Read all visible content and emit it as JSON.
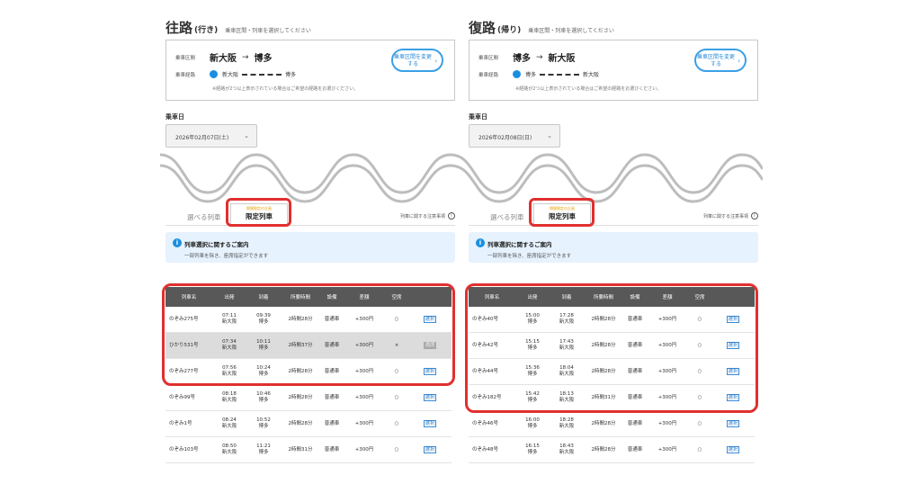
{
  "outbound": {
    "title_main": "往路",
    "title_sub": "(行き)",
    "title_note": "乗車区間・列車を選択してください",
    "route": {
      "section_label": "乗車区間",
      "from": "新大阪",
      "arrow": "→",
      "to": "博多",
      "line_label": "乗車経路",
      "line_from": "新大阪",
      "line_to": "博多",
      "note": "※経路が2つ以上表示されている場合はご希望の経路をお選びください。",
      "change_label": "乗車区間を変更する",
      "chevron": "›"
    },
    "date_label": "乗車日",
    "date_value": "2026年02月07日(土)",
    "date_chevron": "⌄",
    "tabs": {
      "tab1": "選べる列車",
      "tab2_tag": "期間限定の企画",
      "tab2": "限定列車",
      "note": "列車に関する注意事項",
      "info_icon": "i"
    },
    "info": {
      "icon": "i",
      "title": "列車選択に関するご案内",
      "text": "一部列車を除き、座席指定ができます"
    },
    "headers": [
      "列車名",
      "出発",
      "到着",
      "所要時間",
      "設備",
      "差額",
      "空席",
      ""
    ],
    "rows": [
      {
        "name": "のぞみ275号",
        "dep_time": "07:11",
        "dep_st": "新大阪",
        "arr_time": "09:39",
        "arr_st": "博多",
        "dur": "2時間28分",
        "car": "普通車",
        "diff": "+300円",
        "seat": "○",
        "btn": "選択",
        "disabled": false
      },
      {
        "name": "ひかり531号",
        "dep_time": "07:34",
        "dep_st": "新大阪",
        "arr_time": "10:11",
        "arr_st": "博多",
        "dur": "2時間37分",
        "car": "普通車",
        "diff": "+300円",
        "seat": "×",
        "btn": "満席",
        "disabled": true
      },
      {
        "name": "のぞみ277号",
        "dep_time": "07:56",
        "dep_st": "新大阪",
        "arr_time": "10:24",
        "arr_st": "博多",
        "dur": "2時間28分",
        "car": "普通車",
        "diff": "+300円",
        "seat": "○",
        "btn": "選択",
        "disabled": false
      },
      {
        "name": "のぞみ99号",
        "dep_time": "08:18",
        "dep_st": "新大阪",
        "arr_time": "10:46",
        "arr_st": "博多",
        "dur": "2時間28分",
        "car": "普通車",
        "diff": "+300円",
        "seat": "○",
        "btn": "選択",
        "disabled": false
      },
      {
        "name": "のぞみ1号",
        "dep_time": "08:24",
        "dep_st": "新大阪",
        "arr_time": "10:52",
        "arr_st": "博多",
        "dur": "2時間28分",
        "car": "普通車",
        "diff": "+300円",
        "seat": "○",
        "btn": "選択",
        "disabled": false
      },
      {
        "name": "のぞみ103号",
        "dep_time": "08:50",
        "dep_st": "新大阪",
        "arr_time": "11:21",
        "arr_st": "博多",
        "dur": "2時間31分",
        "car": "普通車",
        "diff": "+300円",
        "seat": "○",
        "btn": "選択",
        "disabled": false
      }
    ]
  },
  "return": {
    "title_main": "復路",
    "title_sub": "(帰り)",
    "title_note": "乗車区間・列車を選択してください",
    "route": {
      "section_label": "乗車区間",
      "from": "博多",
      "arrow": "→",
      "to": "新大阪",
      "line_label": "乗車経路",
      "line_from": "博多",
      "line_to": "新大阪",
      "note": "※経路が2つ以上表示されている場合はご希望の経路をお選びください。",
      "change_label": "乗車区間を変更する",
      "chevron": "›"
    },
    "date_label": "乗車日",
    "date_value": "2026年02月08日(日)",
    "date_chevron": "⌄",
    "tabs": {
      "tab1": "選べる列車",
      "tab2_tag": "期間限定の企画",
      "tab2": "限定列車",
      "note": "列車に関する注意事項",
      "info_icon": "i"
    },
    "info": {
      "icon": "i",
      "title": "列車選択に関するご案内",
      "text": "一部列車を除き、座席指定ができます"
    },
    "headers": [
      "列車名",
      "出発",
      "到着",
      "所要時間",
      "設備",
      "差額",
      "空席",
      ""
    ],
    "rows": [
      {
        "name": "のぞみ40号",
        "dep_time": "15:00",
        "dep_st": "博多",
        "arr_time": "17:28",
        "arr_st": "新大阪",
        "dur": "2時間28分",
        "car": "普通車",
        "diff": "+300円",
        "seat": "○",
        "btn": "選択",
        "disabled": false
      },
      {
        "name": "のぞみ42号",
        "dep_time": "15:15",
        "dep_st": "博多",
        "arr_time": "17:43",
        "arr_st": "新大阪",
        "dur": "2時間28分",
        "car": "普通車",
        "diff": "+300円",
        "seat": "○",
        "btn": "選択",
        "disabled": false
      },
      {
        "name": "のぞみ44号",
        "dep_time": "15:36",
        "dep_st": "博多",
        "arr_time": "18:04",
        "arr_st": "新大阪",
        "dur": "2時間28分",
        "car": "普通車",
        "diff": "+300円",
        "seat": "○",
        "btn": "選択",
        "disabled": false
      },
      {
        "name": "のぞみ182号",
        "dep_time": "15:42",
        "dep_st": "博多",
        "arr_time": "18:13",
        "arr_st": "新大阪",
        "dur": "2時間31分",
        "car": "普通車",
        "diff": "+300円",
        "seat": "○",
        "btn": "選択",
        "disabled": false
      },
      {
        "name": "のぞみ46号",
        "dep_time": "16:00",
        "dep_st": "博多",
        "arr_time": "18:28",
        "arr_st": "新大阪",
        "dur": "2時間28分",
        "car": "普通車",
        "diff": "+300円",
        "seat": "○",
        "btn": "選択",
        "disabled": false
      },
      {
        "name": "のぞみ48号",
        "dep_time": "16:15",
        "dep_st": "博多",
        "arr_time": "18:43",
        "arr_st": "新大阪",
        "dur": "2時間28分",
        "car": "普通車",
        "diff": "+300円",
        "seat": "○",
        "btn": "選択",
        "disabled": false
      }
    ]
  },
  "colors": {
    "accent_blue": "#1a8fe0",
    "highlight_red": "#e0302f",
    "table_header": "#585858",
    "info_bg": "#e6f2fd",
    "tag_orange": "#e8a000"
  }
}
